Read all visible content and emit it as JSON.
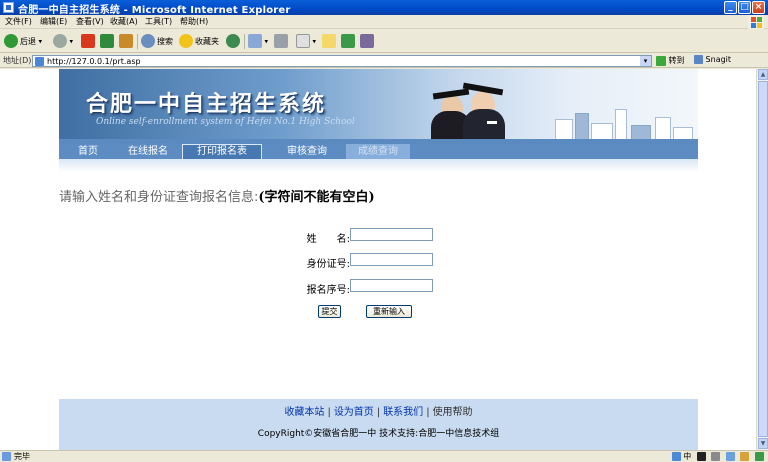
{
  "window": {
    "title": "合肥一中自主招生系统 - Microsoft Internet Explorer",
    "buttons": {
      "minimize": "_",
      "maximize": "□",
      "close": "×"
    }
  },
  "menu": [
    "文件(F)",
    "编辑(E)",
    "查看(V)",
    "收藏(A)",
    "工具(T)",
    "帮助(H)"
  ],
  "toolbar": {
    "back": "后退",
    "search": "搜索",
    "favorites": "收藏夹"
  },
  "address": {
    "label": "地址(D)",
    "url": "http://127.0.0.1/prt.asp",
    "go": "转到",
    "snagit": "Snagit"
  },
  "banner": {
    "title_cn": "合肥一中自主招生系统",
    "title_en": "Online self-enrollment system of Hefei No.1 High School"
  },
  "nav": [
    {
      "label": "首页"
    },
    {
      "label": "在线报名"
    },
    {
      "label": "打印报名表"
    },
    {
      "label": "审核查询"
    },
    {
      "label": "成绩查询"
    }
  ],
  "query": {
    "prompt": "请输入姓名和身份证查询报名信息:",
    "prompt_note": "(字符间不能有空白)",
    "fields": [
      {
        "label": "姓　　名:",
        "value": ""
      },
      {
        "label": "身份证号:",
        "value": ""
      },
      {
        "label": "报名序号:",
        "value": ""
      }
    ],
    "submit": "提交",
    "reset": "重新输入"
  },
  "footer": {
    "links": [
      "收藏本站",
      "设为首页",
      "联系我们",
      "使用帮助"
    ],
    "copyright": "CopyRight©安徽省合肥一中  技术支持:合肥一中信息技术组"
  },
  "status": {
    "text": "完毕",
    "ime": "中"
  },
  "colors": {
    "titlebar": "#0a5fd9",
    "nav_bg": "#5d8cc3",
    "footer_bg": "#c9dbf1",
    "link": "#0033aa"
  }
}
